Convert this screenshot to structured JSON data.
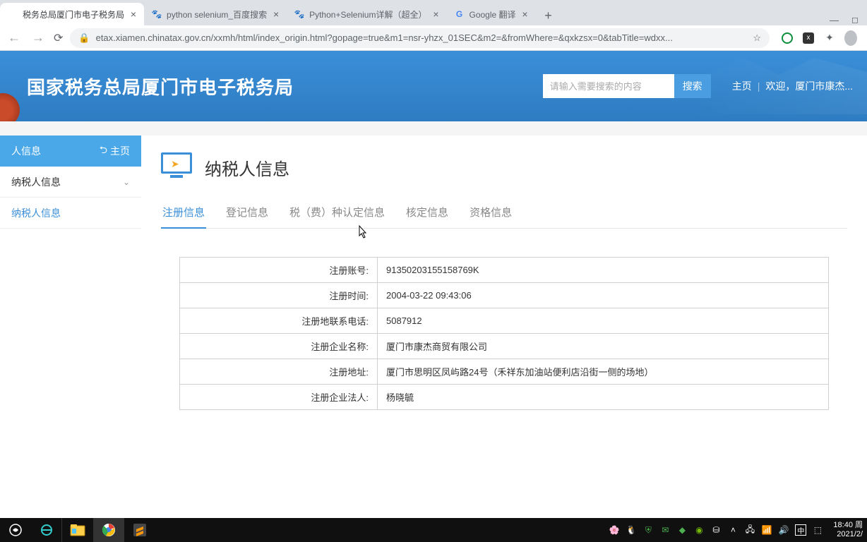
{
  "browser": {
    "tabs": [
      {
        "title": "税务总局厦门市电子税务局",
        "favicon": ""
      },
      {
        "title": "python selenium_百度搜索",
        "favicon": "🐾"
      },
      {
        "title": "Python+Selenium详解（超全）",
        "favicon": "🐾"
      },
      {
        "title": "Google 翻译",
        "favicon": "G"
      }
    ],
    "url": "etax.xiamen.chinatax.gov.cn/xxmh/html/index_origin.html?gopage=true&m1=nsr-yhzx_01SEC&m2=&fromWhere=&qxkzsx=0&tabTitle=wdxx..."
  },
  "site": {
    "title": "国家税务总局厦门市电子税务局",
    "search_placeholder": "请输入需要搜索的内容",
    "search_btn": "搜索",
    "home_link": "主页",
    "welcome_prefix": "欢迎，",
    "welcome_name": "厦门市康杰..."
  },
  "sidebar": {
    "top_left": "人信息",
    "top_right": "主页",
    "items": [
      {
        "label": "纳税人信息",
        "expandable": true,
        "active": false
      },
      {
        "label": "纳税人信息",
        "expandable": false,
        "active": true
      }
    ]
  },
  "page": {
    "title": "纳税人信息",
    "tabs": [
      "注册信息",
      "登记信息",
      "税（费）种认定信息",
      "核定信息",
      "资格信息"
    ],
    "active_tab": 0,
    "rows": [
      {
        "label": "注册账号:",
        "value": "91350203155158769K"
      },
      {
        "label": "注册时间:",
        "value": "2004-03-22 09:43:06"
      },
      {
        "label": "注册地联系电话:",
        "value": "5087912"
      },
      {
        "label": "注册企业名称:",
        "value": "厦门市康杰商贸有限公司"
      },
      {
        "label": "注册地址:",
        "value": "厦门市思明区凤屿路24号（禾祥东加油站便利店沿街一侧的场地）"
      },
      {
        "label": "注册企业法人:",
        "value": "杨晓毓"
      }
    ]
  },
  "taskbar": {
    "time": "18:40",
    "day": "周",
    "date": "2021/2/",
    "ime": "中"
  }
}
